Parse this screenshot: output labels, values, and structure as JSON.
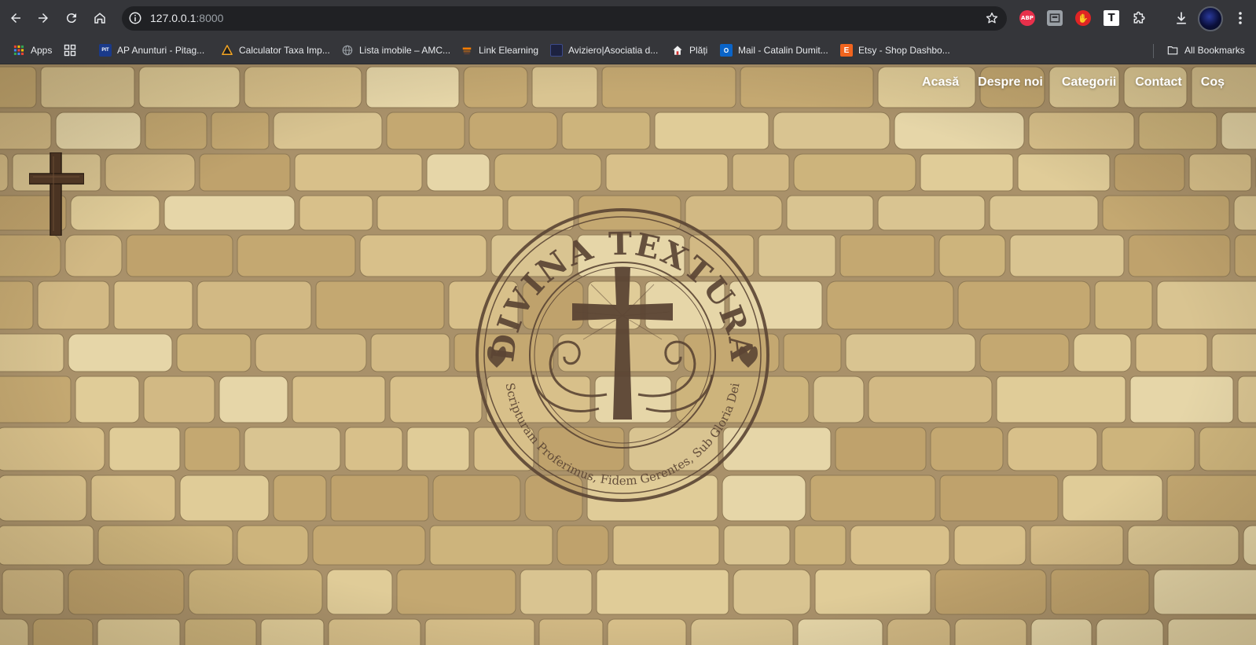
{
  "browser": {
    "url_host": "127.0.0.1",
    "url_port": ":8000",
    "icons": [
      "back-icon",
      "forward-icon",
      "reload-icon",
      "home-icon",
      "site-info-icon",
      "bookmark-star-icon",
      "downloads-icon",
      "menu-icon"
    ],
    "extensions": {
      "abp": "ABP",
      "t": "T"
    }
  },
  "bookmarks": {
    "items": [
      {
        "label": "Apps",
        "icon": "apps-icon"
      },
      {
        "label": "AP Anunturi - Pitag...",
        "icon": "pit-icon",
        "badge": "PIT"
      },
      {
        "label": "Calculator Taxa Imp...",
        "icon": "calculator-icon"
      },
      {
        "label": "Lista imobile – AMC...",
        "icon": "globe-icon"
      },
      {
        "label": "Link Elearning",
        "icon": "elearning-icon"
      },
      {
        "label": "Aviziero|Asociatia d...",
        "icon": "aviziero-icon"
      },
      {
        "label": "Plăți",
        "icon": "house-icon"
      },
      {
        "label": "Mail - Catalin Dumit...",
        "icon": "outlook-icon",
        "badge": "O"
      },
      {
        "label": "Etsy - Shop Dashbo...",
        "icon": "etsy-icon",
        "badge": "E"
      }
    ],
    "all_bookmarks": "All Bookmarks"
  },
  "site": {
    "nav": [
      "Acasă",
      "Despre noi",
      "Categorii",
      "Contact",
      "Coș"
    ],
    "seal_title": "DIVINA TEXTURA",
    "seal_motto": "Scripturam Proferimus, Fidem Gerentes, Sub Gloria Dei"
  },
  "colors": {
    "chrome_bg": "#35363a",
    "omnibox_bg": "#202124",
    "seal_brown": "#5b4534",
    "wall_base": "#c9b27e"
  }
}
